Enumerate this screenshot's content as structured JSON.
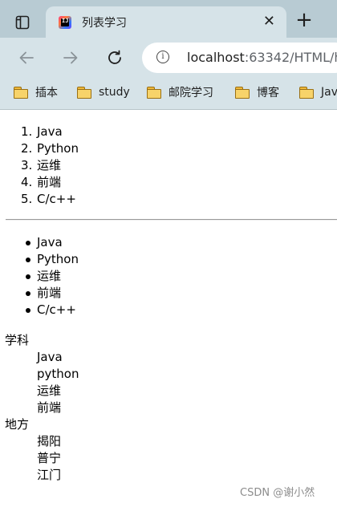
{
  "tab": {
    "title": "列表学习",
    "favicon_text": "IJ"
  },
  "toolbar": {
    "url_host": "localhost",
    "url_rest": ":63342/HTML/h"
  },
  "bookmarks": [
    {
      "label": "插本"
    },
    {
      "label": "study"
    },
    {
      "label": "邮院学习"
    },
    {
      "label": "博客"
    },
    {
      "label": "Jav"
    }
  ],
  "ordered_list": [
    {
      "num": "1.",
      "text": "Java"
    },
    {
      "num": "2.",
      "text": "Python"
    },
    {
      "num": "3.",
      "text": "运维"
    },
    {
      "num": "4.",
      "text": "前端"
    },
    {
      "num": "5.",
      "text": "C/c++"
    }
  ],
  "unordered_list": [
    "Java",
    "Python",
    "运维",
    "前端",
    "C/c++"
  ],
  "definition_list": {
    "groups": [
      {
        "term": "学科",
        "items": [
          "Java",
          "python",
          "运维",
          "前端"
        ]
      },
      {
        "term": "地方",
        "items": [
          "揭阳",
          "普宁",
          "江门"
        ]
      }
    ]
  },
  "watermark": "CSDN @谢小然"
}
